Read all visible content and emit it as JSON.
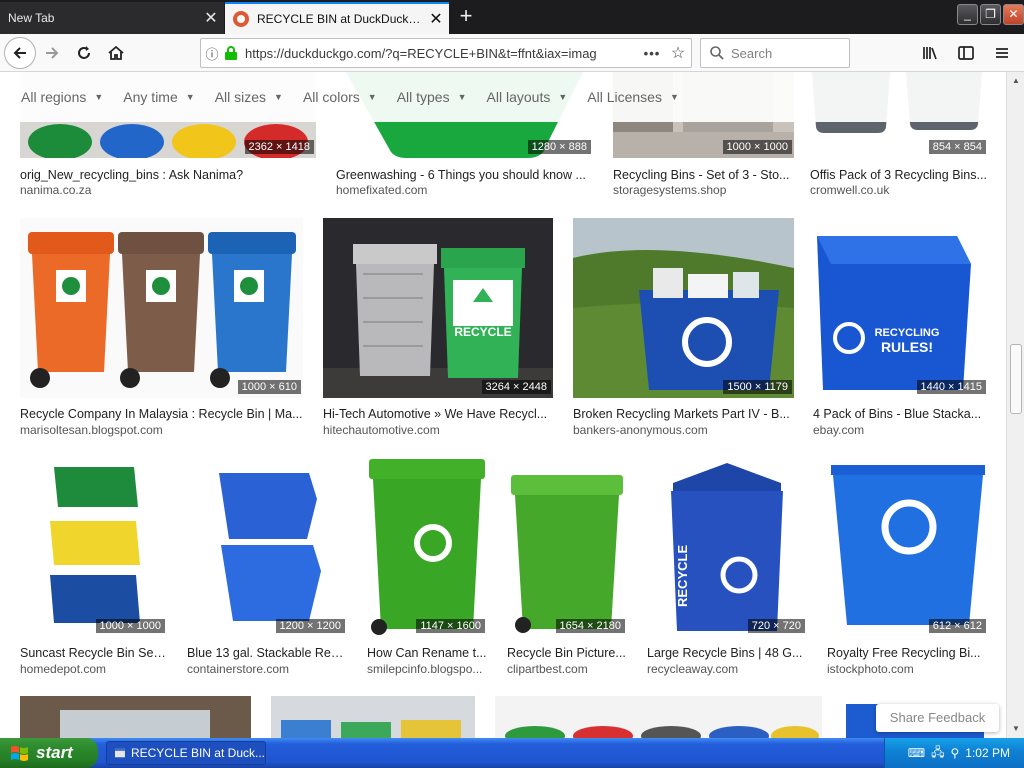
{
  "browser": {
    "tabs": [
      {
        "label": "New Tab",
        "active": false
      },
      {
        "label": "RECYCLE BIN at DuckDuckGo",
        "active": true
      }
    ],
    "url": "https://duckduckgo.com/?q=RECYCLE+BIN&t=ffnt&iax=imag",
    "search_placeholder": "Search"
  },
  "filters": [
    {
      "label": "All regions"
    },
    {
      "label": "Any time"
    },
    {
      "label": "All sizes"
    },
    {
      "label": "All colors"
    },
    {
      "label": "All types"
    },
    {
      "label": "All layouts"
    },
    {
      "label": "All Licenses"
    }
  ],
  "rows": [
    [
      {
        "title": "orig_New_recycling_bins : Ask Nanima?",
        "source": "nanima.co.za",
        "dims": "2362 × 1418"
      },
      {
        "title": "Greenwashing - 6 Things you should know ...",
        "source": "homefixated.com",
        "dims": "1280 × 888"
      },
      {
        "title": "Recycling Bins - Set of 3 - Sto...",
        "source": "storagesystems.shop",
        "dims": "1000 × 1000"
      },
      {
        "title": "Offis Pack of 3 Recycling Bins...",
        "source": "cromwell.co.uk",
        "dims": "854 × 854"
      }
    ],
    [
      {
        "title": "Recycle Company In Malaysia : Recycle Bin | Ma...",
        "source": "marisoltesan.blogspot.com",
        "dims": "1000 × 610"
      },
      {
        "title": "Hi-Tech Automotive » We Have Recycl...",
        "source": "hitechautomotive.com",
        "dims": "3264 × 2448",
        "label": "RECYCLE"
      },
      {
        "title": "Broken Recycling Markets Part IV - B...",
        "source": "bankers-anonymous.com",
        "dims": "1500 × 1179"
      },
      {
        "title": "4 Pack of Bins - Blue Stacka...",
        "source": "ebay.com",
        "dims": "1440 × 1415",
        "label1": "RECYCLING",
        "label2": "RULES!"
      }
    ],
    [
      {
        "title": "Suncast Recycle Bin Set...",
        "source": "homedepot.com",
        "dims": "1000 × 1000"
      },
      {
        "title": "Blue 13 gal. Stackable Rec...",
        "source": "containerstore.com",
        "dims": "1200 × 1200"
      },
      {
        "title": "How Can Rename t...",
        "source": "smilepcinfo.blogspo...",
        "dims": "1147 × 1600"
      },
      {
        "title": "Recycle Bin Picture...",
        "source": "clipartbest.com",
        "dims": "1654 × 2180"
      },
      {
        "title": "Large Recycle Bins | 48 G...",
        "source": "recycleaway.com",
        "dims": "720 × 720",
        "label": "RECYCLE"
      },
      {
        "title": "Royalty Free Recycling Bi...",
        "source": "istockphoto.com",
        "dims": "612 × 612"
      }
    ]
  ],
  "share_feedback": "Share Feedback",
  "taskbar": {
    "start": "start",
    "item": "RECYCLE BIN at Duck...",
    "time": "1:02 PM"
  }
}
